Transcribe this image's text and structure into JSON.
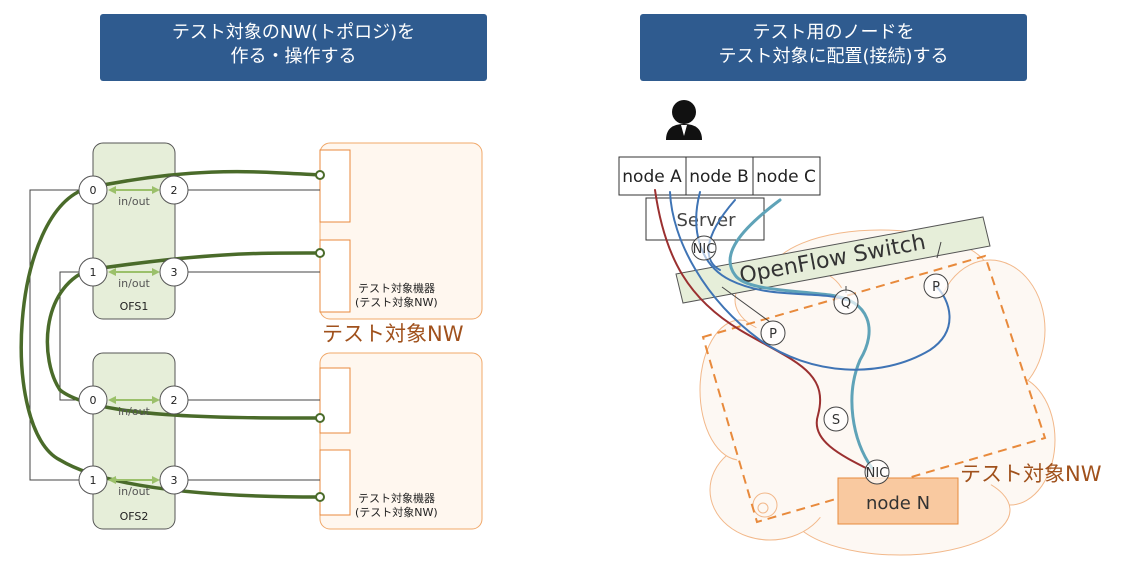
{
  "left_banner": {
    "line1": "テスト対象のNW(トポロジ)を",
    "line2": "作る・操作する"
  },
  "right_banner": {
    "line1": "テスト用のノードを",
    "line2": "テスト対象に配置(接続)する"
  },
  "left_diagram": {
    "ofs1": {
      "label": "OFS1",
      "ports": [
        "0",
        "2",
        "1",
        "3"
      ],
      "inout": "in/out"
    },
    "ofs2": {
      "label": "OFS2",
      "ports": [
        "0",
        "2",
        "1",
        "3"
      ],
      "inout": "in/out"
    },
    "device_label_line1": "テスト対象機器",
    "device_label_line2": "(テスト対象NW)",
    "nw_label": "テスト対象NW"
  },
  "right_diagram": {
    "nodes": [
      "node A",
      "node B",
      "node C"
    ],
    "server": "Server",
    "nic_top": "NIC",
    "switch": "OpenFlow Switch",
    "ports": {
      "p_top": "P",
      "q": "Q",
      "p_mid": "P",
      "s": "S"
    },
    "nic_bottom": "NIC",
    "node_n": "node N",
    "nw_label": "テスト対象NW"
  },
  "colors": {
    "banner": "#2f5b8f",
    "ofs_fill": "#e6eed9",
    "cable": "#4a6b2a",
    "arrow": "#9bc06a",
    "orange": "#e88a3c",
    "nw_text": "#a0511c",
    "blue_line": "#3f74b5",
    "red_line": "#9b3030",
    "teal_line": "#5fa3b8",
    "node_n_fill": "#f9c9a0"
  },
  "icons": [
    "user-icon"
  ]
}
